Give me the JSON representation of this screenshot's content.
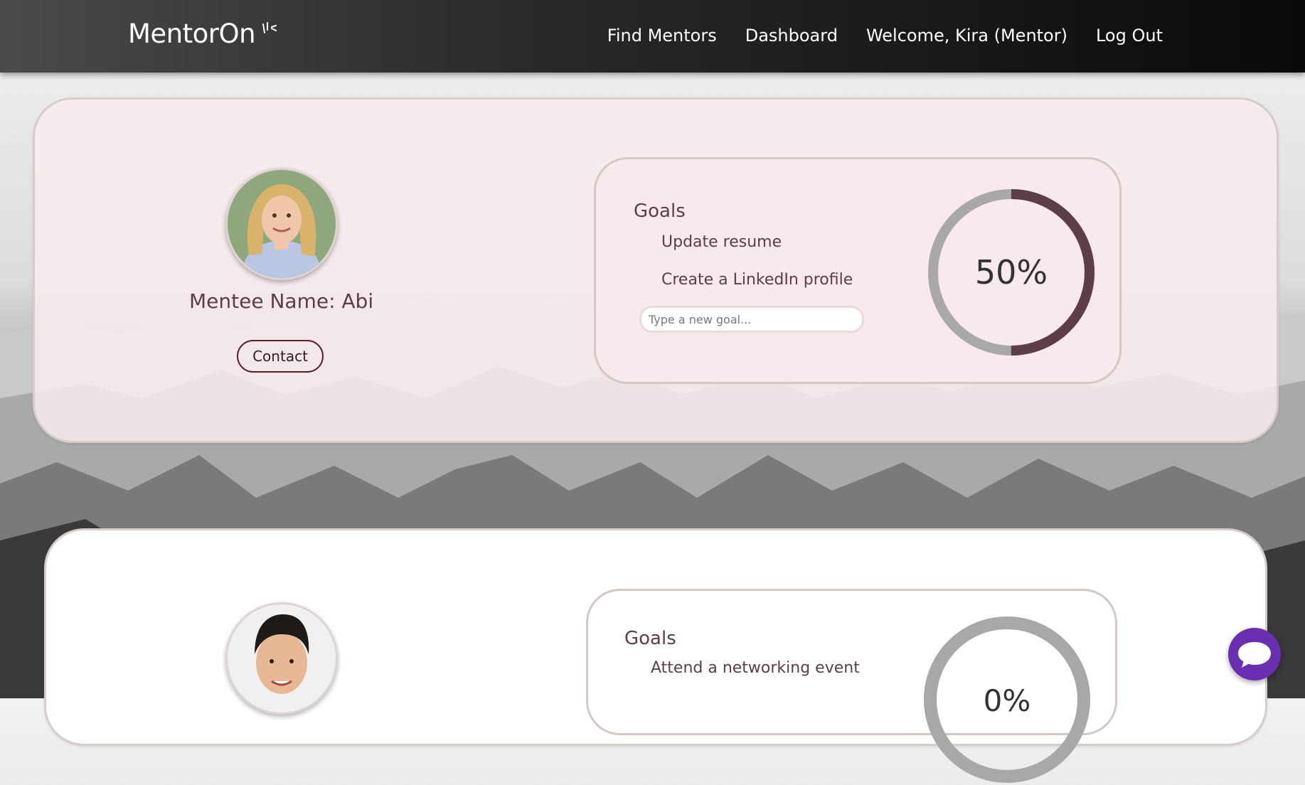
{
  "app": {
    "logo_text": "MentorOn"
  },
  "nav": {
    "items": [
      {
        "label": "Find Mentors"
      },
      {
        "label": "Dashboard"
      },
      {
        "label": "Welcome, Kira (Mentor)"
      },
      {
        "label": "Log Out"
      }
    ]
  },
  "mentees": [
    {
      "name_label": "Mentee Name: Abi",
      "contact_label": "Contact",
      "goals_title": "Goals",
      "goals": [
        "Update resume",
        "Create a LinkedIn profile"
      ],
      "goal_placeholder": "Type a new goal...",
      "progress_text": "50%",
      "progress_fraction": 0.5
    },
    {
      "goals_title": "Goals",
      "goals": [
        "Attend a networking event"
      ],
      "progress_text": "0%",
      "progress_fraction": 0
    }
  ],
  "colors": {
    "accent": "#5c3e46",
    "ring_track": "#a8a8a8",
    "chat_button": "#6a2fb0",
    "card_tint": "#f8ecee"
  },
  "icons": {
    "chat": "chat-bubble-icon",
    "logo_mark": "sparkle-icon"
  }
}
